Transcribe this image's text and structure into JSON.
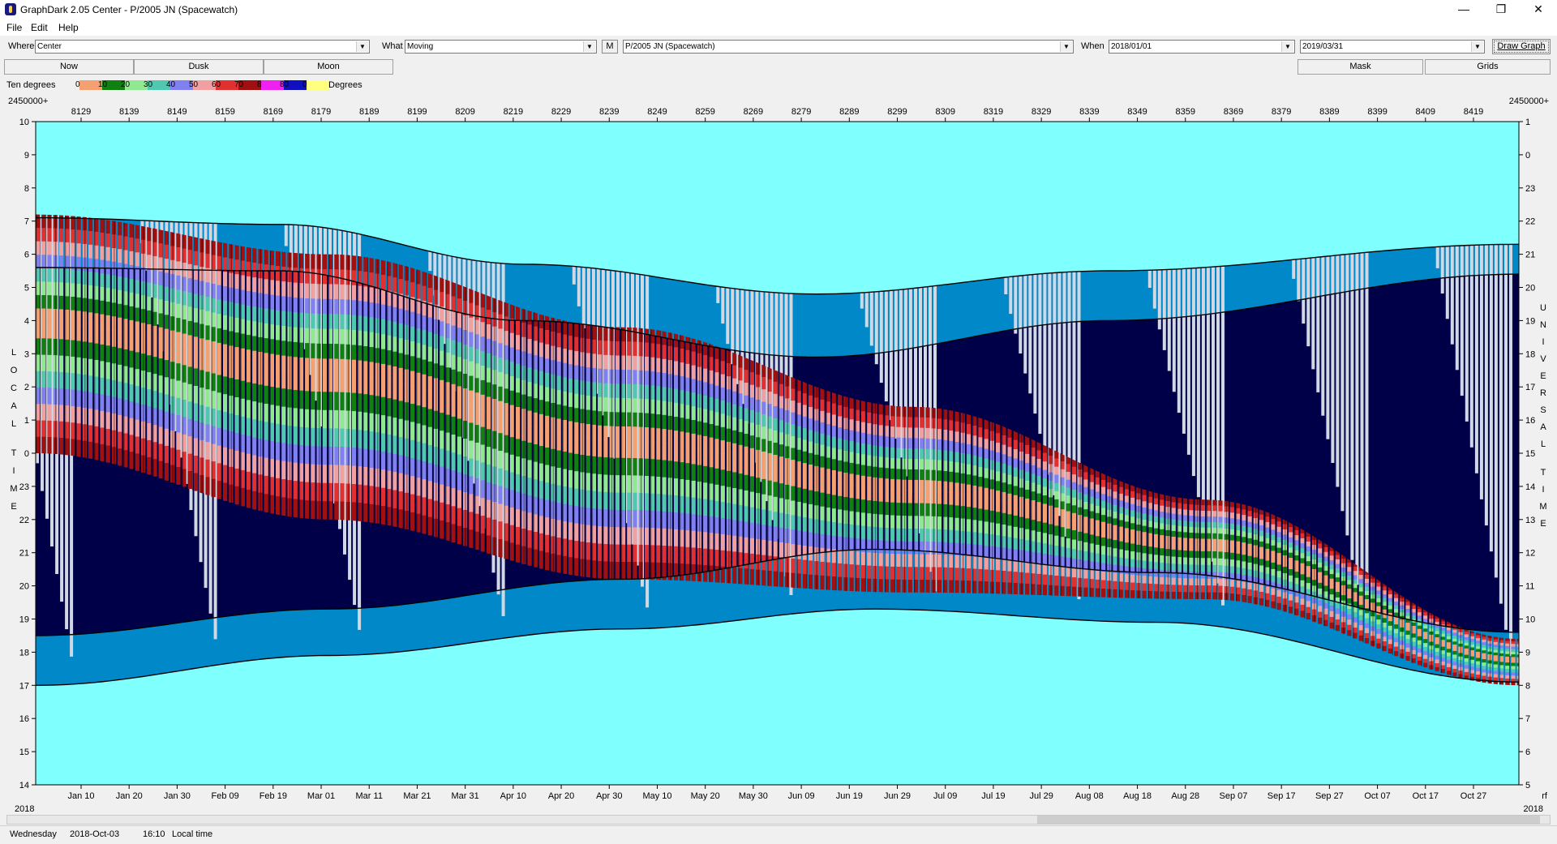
{
  "window": {
    "title": "GraphDark 2.05  Center  -  P/2005 JN (Spacewatch)",
    "minimize": "—",
    "maximize": "❐",
    "close": "✕"
  },
  "menu": [
    "File",
    "Edit",
    "Help"
  ],
  "toolbar": {
    "where_label": "Where",
    "where_value": "Center",
    "what_label": "What",
    "what_value": "Moving",
    "m_button": "M",
    "object_value": "P/2005 JN (Spacewatch)",
    "when_label": "When",
    "start_date": "2018/01/01",
    "end_date": "2019/03/31",
    "draw_button": "Draw Graph"
  },
  "toolbar2": {
    "now": "Now",
    "dusk": "Dusk",
    "moon": "Moon",
    "mask": "Mask",
    "grids": "Grids"
  },
  "legend": {
    "label": "Ten degrees",
    "units": "Degrees",
    "swatches": [
      {
        "text": "0",
        "color": "#f4a070"
      },
      {
        "text": "10",
        "color": "#108010"
      },
      {
        "text": "20",
        "color": "#90e890"
      },
      {
        "text": "30",
        "color": "#50c8b0"
      },
      {
        "text": "40",
        "color": "#8080f0"
      },
      {
        "text": "50",
        "color": "#f0a0a0"
      },
      {
        "text": "60",
        "color": "#e03030"
      },
      {
        "text": "70",
        "color": "#a01010"
      },
      {
        "text": "8",
        "color": "#f020f0"
      },
      {
        "text": "80",
        "color": "#1010c0"
      },
      {
        "text": "0",
        "color": "#ffff80"
      }
    ]
  },
  "chart_data": {
    "type": "area",
    "jd_prefix": "2450000+",
    "jd_ticks": [
      "8129",
      "8139",
      "8149",
      "8159",
      "8169",
      "8179",
      "8189",
      "8199",
      "8209",
      "8219",
      "8229",
      "8239",
      "8249",
      "8259",
      "8269",
      "8279",
      "8289",
      "8299",
      "8309",
      "8319",
      "8329",
      "8339",
      "8349",
      "8359",
      "8369",
      "8379",
      "8389",
      "8399",
      "8409",
      "8419"
    ],
    "date_ticks": [
      "Jan 10",
      "Jan 20",
      "Jan 30",
      "Feb 09",
      "Feb 19",
      "Mar 01",
      "Mar 11",
      "Mar 21",
      "Mar 31",
      "Apr 10",
      "Apr 20",
      "Apr 30",
      "May 10",
      "May 20",
      "May 30",
      "Jun 09",
      "Jun 19",
      "Jun 29",
      "Jul 09",
      "Jul 19",
      "Jul 29",
      "Aug 08",
      "Aug 18",
      "Aug 28",
      "Sep 07",
      "Sep 17",
      "Sep 27",
      "Oct 07",
      "Oct 17",
      "Oct 27"
    ],
    "year_left": "2018",
    "year_right": "2018",
    "right_corner": "rf",
    "left_ticks": [
      "10",
      "9",
      "8",
      "7",
      "6",
      "5",
      "4",
      "3",
      "2",
      "1",
      "0",
      "23",
      "22",
      "21",
      "20",
      "19",
      "18",
      "17",
      "16",
      "15",
      "14"
    ],
    "right_ticks": [
      "1",
      "0",
      "23",
      "22",
      "21",
      "20",
      "19",
      "18",
      "17",
      "16",
      "15",
      "14",
      "13",
      "12",
      "11",
      "10",
      "9",
      "8",
      "7",
      "6",
      "5"
    ],
    "left_axis_label": "LOCAL TIME",
    "right_axis_label": "UNIVERSAL TIME",
    "x_range_days": [
      0,
      304
    ],
    "y_range_hours": [
      14,
      34
    ],
    "curves": {
      "dusk_end_hour": [
        [
          0,
          17.0
        ],
        [
          60,
          17.9
        ],
        [
          120,
          18.7
        ],
        [
          172,
          19.3
        ],
        [
          230,
          18.9
        ],
        [
          304,
          17.1
        ]
      ],
      "dusk_start_hour": [
        [
          0,
          18.5
        ],
        [
          60,
          19.3
        ],
        [
          120,
          20.2
        ],
        [
          172,
          21.1
        ],
        [
          230,
          20.4
        ],
        [
          304,
          18.6
        ]
      ],
      "dawn_start_hour": [
        [
          0,
          29.6
        ],
        [
          50,
          29.5
        ],
        [
          100,
          28.0
        ],
        [
          160,
          26.9
        ],
        [
          220,
          28.0
        ],
        [
          304,
          29.4
        ]
      ],
      "dawn_end_hour": [
        [
          0,
          31.1
        ],
        [
          50,
          30.9
        ],
        [
          100,
          29.7
        ],
        [
          160,
          28.8
        ],
        [
          220,
          29.5
        ],
        [
          304,
          30.3
        ]
      ],
      "object_band_top": [
        [
          0,
          31.2
        ],
        [
          60,
          30.0
        ],
        [
          120,
          27.8
        ],
        [
          180,
          25.4
        ],
        [
          240,
          22.6
        ],
        [
          304,
          18.4
        ]
      ],
      "object_band_bottom": [
        [
          0,
          24.0
        ],
        [
          60,
          22.0
        ],
        [
          120,
          20.2
        ],
        [
          180,
          19.8
        ],
        [
          240,
          19.6
        ],
        [
          304,
          17.0
        ]
      ]
    },
    "colors": {
      "day": "#80ffff",
      "twilight": "#0088c8",
      "night": "#000048",
      "moonlight": "#d0d8e4",
      "altitude_bands": [
        "#f4a070",
        "#108010",
        "#90e890",
        "#50c8b0",
        "#8080f0",
        "#f0a0a0",
        "#e03030",
        "#a01010"
      ]
    }
  },
  "status": {
    "day": "Wednesday",
    "date": "2018-Oct-03",
    "time": "16:10",
    "mode": "Local time"
  }
}
